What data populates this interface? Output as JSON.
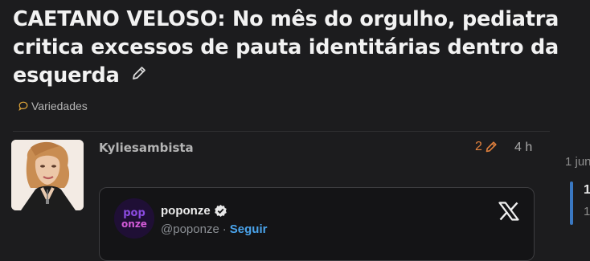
{
  "topic": {
    "title": "CAETANO VELOSO: No mês do orgulho, pediatra critica excessos de pauta identitárias dentro da esquerda",
    "category": "Variedades",
    "category_color": "#e0a63a"
  },
  "post": {
    "username": "Kyliesambista",
    "edit_count": "2",
    "time": "4 h"
  },
  "timeline": {
    "date": "1 jun",
    "current": "1",
    "total": "1"
  },
  "embed": {
    "name": "poponze",
    "handle": "@poponze",
    "separator": "·",
    "follow_label": "Seguir",
    "avatar_text_top": "pop",
    "avatar_text_bottom": "onze",
    "platform_icon": "x-logo-icon"
  },
  "colors": {
    "background": "#1c1c1e",
    "accent_orange": "#e0803d",
    "link_blue": "#4aa3ea",
    "timeline_blue": "#3a78c2"
  }
}
